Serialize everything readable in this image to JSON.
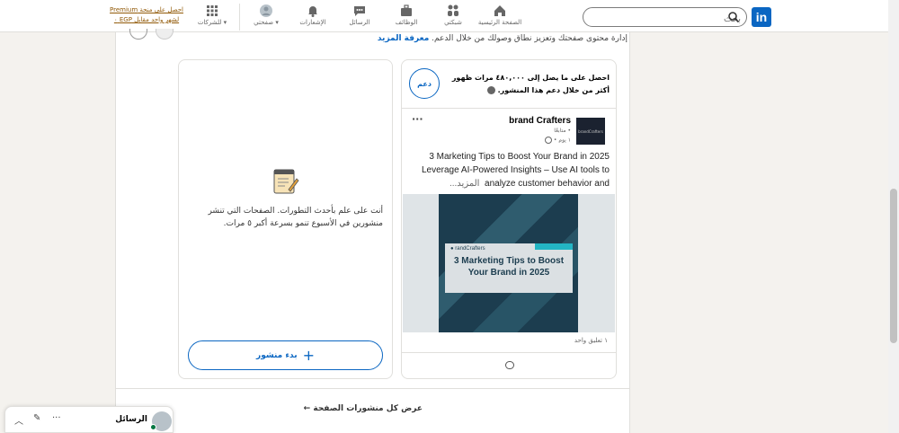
{
  "colors": {
    "accent": "#0a66c2",
    "premium": "#915907",
    "online": "#057642"
  },
  "topnav": {
    "logo": "in",
    "search_placeholder": "بحث",
    "items": [
      {
        "label": "الصفحة الرئيسية",
        "icon": "home-icon"
      },
      {
        "label": "شبكتي",
        "icon": "network-icon"
      },
      {
        "label": "الوظائف",
        "icon": "briefcase-icon"
      },
      {
        "label": "الرسائل",
        "icon": "messaging-icon"
      },
      {
        "label": "الإشعارات",
        "icon": "bell-icon"
      },
      {
        "label": "صفحتي",
        "icon": "avatar-icon"
      },
      {
        "label": "للشركات",
        "icon": "grid-icon"
      }
    ],
    "premium_line1": "احصل على منحة Premium",
    "premium_line2": "لشهر واحد مقابل EGP ٠"
  },
  "page": {
    "learn_text": "إدارة محتوى صفحتك وتعزيز نطاق وصولك من خلال الدعم.",
    "learn_link": "معرفة المزيد"
  },
  "boost_panel": {
    "title": "احصل على ما يصل إلى ٤٨٠,٠٠٠ مرات ظهور أكثر من خلال دعم هذا المنشور.",
    "button": "دعم",
    "post": {
      "logo_text": "brandCrafters",
      "author": "brand Crafters",
      "followers": "• متابعًا",
      "time": "١ يوم •",
      "text_line1": "3 Marketing Tips to Boost Your Brand in 2025",
      "text_line2": "Leverage AI-Powered Insights – Use AI tools to",
      "text_line3": "analyze customer behavior and",
      "more": "...المزيد",
      "image_brand": "randCrafters",
      "image_headline": "3 Marketing Tips to Boost Your Brand in 2025",
      "comments": "١ تعليق واحد"
    }
  },
  "empty_panel": {
    "text": "أنت على علم بأحدث التطورات. الصفحات التي تنشر منشورين في الأسبوع تنمو بسرعة أكبر ٥ مرات.",
    "button": "بدء منشور"
  },
  "view_all": "عرض كل منشورات الصفحة",
  "messaging": {
    "title": "الرسائل"
  }
}
